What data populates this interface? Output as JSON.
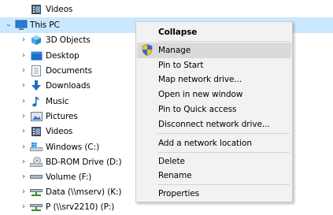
{
  "tree": {
    "items": [
      {
        "label": "Videos",
        "icon": "videos-folder-icon"
      },
      {
        "label": "This PC",
        "icon": "this-pc-icon"
      },
      {
        "label": "3D Objects",
        "icon": "3d-objects-icon"
      },
      {
        "label": "Desktop",
        "icon": "desktop-folder-icon"
      },
      {
        "label": "Documents",
        "icon": "documents-folder-icon"
      },
      {
        "label": "Downloads",
        "icon": "downloads-folder-icon"
      },
      {
        "label": "Music",
        "icon": "music-folder-icon"
      },
      {
        "label": "Pictures",
        "icon": "pictures-folder-icon"
      },
      {
        "label": "Videos",
        "icon": "videos-folder-icon"
      },
      {
        "label": "Windows (C:)",
        "icon": "windows-drive-icon"
      },
      {
        "label": "BD-ROM Drive (D:)",
        "icon": "optical-drive-icon"
      },
      {
        "label": "Volume (F:)",
        "icon": "drive-icon"
      },
      {
        "label": "Data (\\\\mserv) (K:)",
        "icon": "network-drive-icon"
      },
      {
        "label": "P (\\\\srv2210) (P:)",
        "icon": "network-drive-icon"
      }
    ],
    "selected_label": "This PC"
  },
  "context_menu": {
    "items": [
      {
        "label": "Collapse",
        "bold": true
      },
      {
        "label": "Manage",
        "icon": "shield-icon",
        "highlighted": true
      },
      {
        "label": "Pin to Start"
      },
      {
        "label": "Map network drive..."
      },
      {
        "label": "Open in new window"
      },
      {
        "label": "Pin to Quick access"
      },
      {
        "label": "Disconnect network drive..."
      },
      {
        "label": "Add a network location"
      },
      {
        "label": "Delete"
      },
      {
        "label": "Rename"
      },
      {
        "label": "Properties"
      }
    ]
  },
  "colors": {
    "selection": "#cce8ff",
    "menu_background": "#f2f2f2",
    "menu_hover": "#dadada"
  }
}
